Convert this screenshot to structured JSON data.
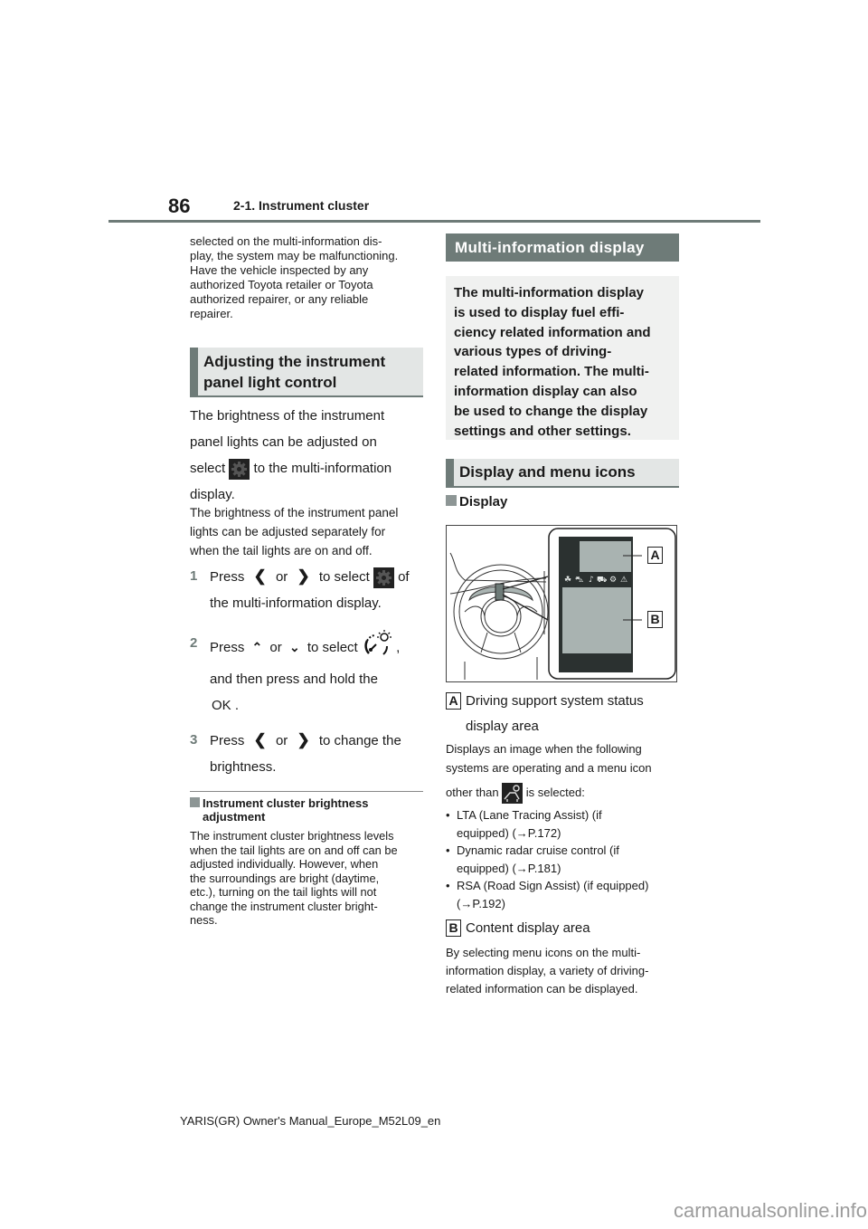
{
  "header": {
    "page_number": "86",
    "chapter": "2-1. Instrument cluster"
  },
  "left": {
    "continued_text": "selected on the multi-information dis-play, the system may be malfunctioning. Have the vehicle inspected by any authorized Toyota retailer or Toyota authorized repairer, or any reliable repairer.",
    "continued_lines": [
      "selected on the multi-information dis-",
      "play, the system may be malfunctioning.",
      "Have the vehicle inspected by any",
      "authorized Toyota retailer or Toyota",
      "authorized repairer, or any reliable",
      "repairer."
    ],
    "section_title_lines": [
      "Adjusting the instrument",
      "panel light control"
    ],
    "intro_lines": [
      "The brightness of the instrument",
      "panel lights can be adjusted on"
    ],
    "intro_select": "select",
    "intro_after_icon": "to the multi-information",
    "intro_end": "display.",
    "note_lines": [
      "The brightness of the instrument panel",
      "lights can be adjusted separately for",
      "when the tail lights are on and off."
    ],
    "steps": [
      {
        "num": "1",
        "press": "Press",
        "or": "or",
        "action": "to select",
        "suffix": "of",
        "line2": "the multi-information display.",
        "left_icon": "chevron-left-icon",
        "right_icon": "chevron-right-icon",
        "target_icon": "gear-icon"
      },
      {
        "num": "2",
        "press": "Press",
        "or": "or",
        "action": "to select",
        "suffix": ",",
        "line2": "and then press and hold the",
        "line3": "OK .",
        "left_icon": "chevron-up-icon",
        "right_icon": "chevron-down-icon",
        "target_icon": "brightness-gauge-icon"
      },
      {
        "num": "3",
        "press": "Press",
        "or": "or",
        "action": "to change the",
        "line2": "brightness.",
        "left_icon": "chevron-left-icon",
        "right_icon": "chevron-right-icon"
      }
    ],
    "subsection_title_lines": [
      "Instrument cluster brightness",
      "adjustment"
    ],
    "subsection_lines": [
      "The instrument cluster brightness levels",
      "when the tail lights are on and off can be",
      "adjusted individually. However, when",
      "the surroundings are bright (daytime,",
      "etc.), turning on the tail lights will not",
      "change the instrument cluster bright-",
      "ness."
    ]
  },
  "right": {
    "section_title": "Multi-information display",
    "intro_lines": [
      "The multi-information display",
      "is used to display fuel effi-",
      "ciency related information and",
      "various types of driving-",
      "related information. The multi-",
      "information display can also",
      "be used to change the display",
      "settings and other settings."
    ],
    "subsection_title": "Display and menu icons",
    "display_heading": "Display",
    "figure": {
      "callouts": [
        "A",
        "B"
      ],
      "menu_icons": [
        "leaf-icon",
        "driver-assist-icon",
        "music-note-icon",
        "vehicle-info-icon",
        "gear-icon",
        "warning-icon"
      ]
    },
    "items": [
      {
        "label": "A",
        "title_lines": [
          "Driving support system status",
          "display area"
        ],
        "desc_lines": [
          "Displays an image when the following",
          "systems are operating and a menu icon"
        ],
        "desc_other_than": "other than",
        "desc_selected": "is selected:",
        "bullets": [
          {
            "line1": "LTA (Lane Tracing Assist) (if",
            "line2": "equipped) (→P.172)"
          },
          {
            "line1": "Dynamic radar cruise control (if",
            "line2": "equipped) (→P.181)"
          },
          {
            "line1": "RSA (Road Sign Assist) (if equipped)",
            "line2": "(→P.192)"
          }
        ]
      },
      {
        "label": "B",
        "title_lines": [
          "Content display area"
        ],
        "desc_lines": [
          "By selecting menu icons on the multi-",
          "information display, a variety of driving-",
          "related information can be displayed."
        ]
      }
    ]
  },
  "footer": {
    "manual_id": "YARIS(GR) Owner's Manual_Europe_M52L09_en",
    "watermark": "carmanualsonline.info"
  }
}
